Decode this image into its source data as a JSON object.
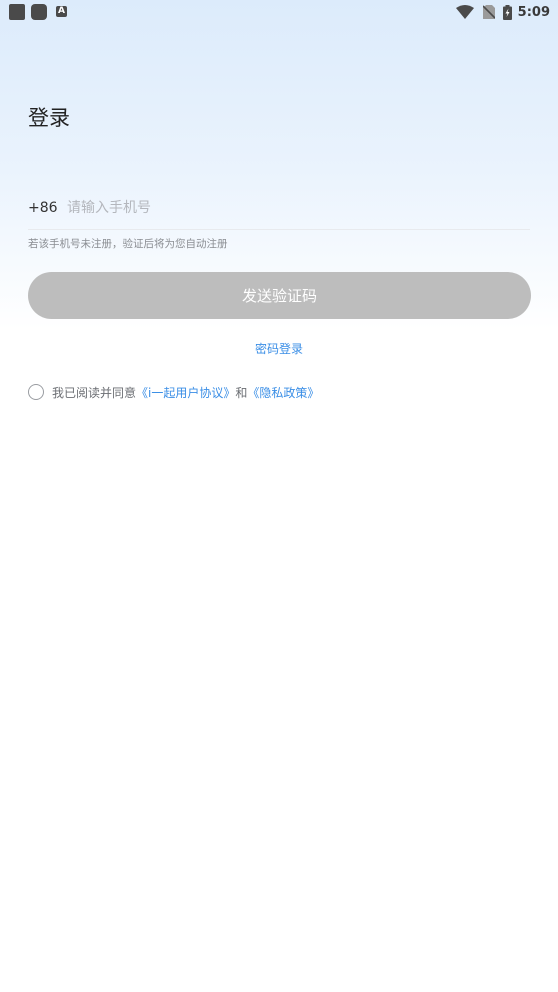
{
  "status_bar": {
    "time": "5:09",
    "icons": [
      "app-square-icon",
      "app-rounded-icon",
      "a-badge-icon",
      "wifi-icon",
      "no-sim-icon",
      "battery-charging-icon"
    ],
    "a_badge": "A"
  },
  "page": {
    "title": "登录"
  },
  "phone": {
    "country_code": "+86",
    "value": "",
    "placeholder": "请输入手机号"
  },
  "hint": "若该手机号未注册，验证后将为您自动注册",
  "send_code_button": "发送验证码",
  "password_login_link": "密码登录",
  "agreement": {
    "checked": false,
    "prefix": "我已阅读并同意",
    "user_agreement": "《i一起用户协议》",
    "connector": "和",
    "privacy_policy": "《隐私政策》"
  },
  "colors": {
    "link": "#3a8ee6",
    "button_disabled": "#bdbdbd",
    "gradient_top": "#dcebfb"
  }
}
